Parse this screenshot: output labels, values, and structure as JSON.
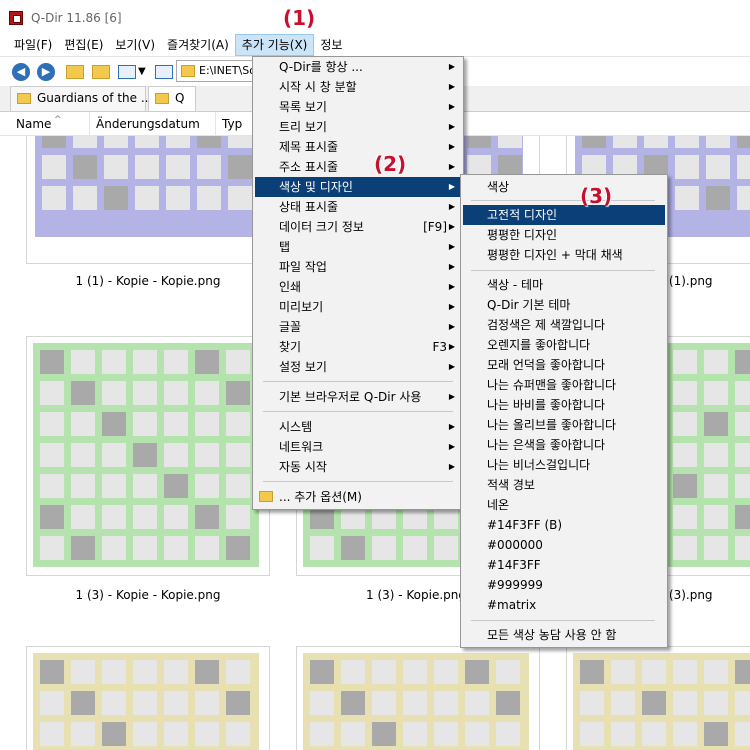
{
  "window": {
    "title": "Q-Dir 11.86 [6]"
  },
  "menubar": {
    "items": [
      "파일(F)",
      "편집(E)",
      "보기(V)",
      "즐겨찾기(A)",
      "추가 기능(X)",
      "정보"
    ]
  },
  "toolbar": {
    "address": "E:\\INET\\So"
  },
  "tabs": [
    "Guardians of the ...",
    "Q"
  ],
  "columns": [
    "Name",
    "Änderungsdatum",
    "Typ"
  ],
  "thumbnails": {
    "row2_labels": [
      "1 (1) - Kopie - Kopie.png",
      "1 (1).png"
    ],
    "row3_labels": [
      "1 (3) - Kopie - Kopie.png",
      "1 (3) - Kopie.png",
      "1 (3).png"
    ]
  },
  "steps": [
    "(1)",
    "(2)",
    "(3)"
  ],
  "main_menu": {
    "items": [
      {
        "label": "Q-Dir를 항상 ...",
        "shortcut": "",
        "sub": true
      },
      {
        "label": "시작 시 창 분할",
        "shortcut": "",
        "sub": true
      },
      {
        "label": "목록 보기",
        "shortcut": "",
        "sub": true
      },
      {
        "label": "트리 보기",
        "shortcut": "",
        "sub": true
      },
      {
        "label": "제목 표시줄",
        "shortcut": "",
        "sub": true
      },
      {
        "label": "주소 표시줄",
        "shortcut": "",
        "sub": true
      },
      {
        "label": "색상 및 디자인",
        "shortcut": "",
        "sub": true
      },
      {
        "label": "상태 표시줄",
        "shortcut": "",
        "sub": true
      },
      {
        "label": "데이터 크기 정보",
        "shortcut": "[F9]",
        "sub": true
      },
      {
        "label": "탭",
        "shortcut": "",
        "sub": true
      },
      {
        "label": "파일 작업",
        "shortcut": "",
        "sub": true
      },
      {
        "label": "인쇄",
        "shortcut": "",
        "sub": true
      },
      {
        "label": "미리보기",
        "shortcut": "",
        "sub": true
      },
      {
        "label": "글꼴",
        "shortcut": "",
        "sub": true
      },
      {
        "label": "찾기",
        "shortcut": "F3",
        "sub": true
      },
      {
        "label": "설정 보기",
        "shortcut": "",
        "sub": true
      },
      {
        "label": "기본 브라우저로 Q-Dir 사용",
        "shortcut": "",
        "sub": true
      },
      {
        "label": "시스템",
        "shortcut": "",
        "sub": true
      },
      {
        "label": "네트워크",
        "shortcut": "",
        "sub": true
      },
      {
        "label": "자동 시작",
        "shortcut": "",
        "sub": true
      },
      {
        "label": "... 추가 옵션(M)",
        "shortcut": "",
        "sub": false
      }
    ]
  },
  "color_menu": {
    "items": [
      "색상",
      "고전적 디자인",
      "평평한 디자인",
      "평평한 디자인 + 막대 채색",
      "색상 - 테마",
      "Q-Dir 기본 테마",
      "검정색은 제 색깔입니다",
      "오렌지를 좋아합니다",
      "모래 언덕을 좋아합니다",
      "나는 슈퍼맨을 좋아합니다",
      "나는 바비를 좋아합니다",
      "나는 올리브를 좋아합니다",
      "나는 은색을 좋아합니다",
      "나는 비너스걸입니다",
      "적색 경보",
      "네온",
      "#14F3FF (B)",
      "#000000",
      "#14F3FF",
      "#999999",
      "#matrix",
      "모든 색상 농담 사용 안 함"
    ]
  },
  "colors": {
    "highlight": "#0a3f77",
    "step_red": "#c8102e",
    "purple_grid": "#b3b3e6",
    "green_grid": "#b5e3ad",
    "yellow_grid": "#e6e0b3"
  }
}
